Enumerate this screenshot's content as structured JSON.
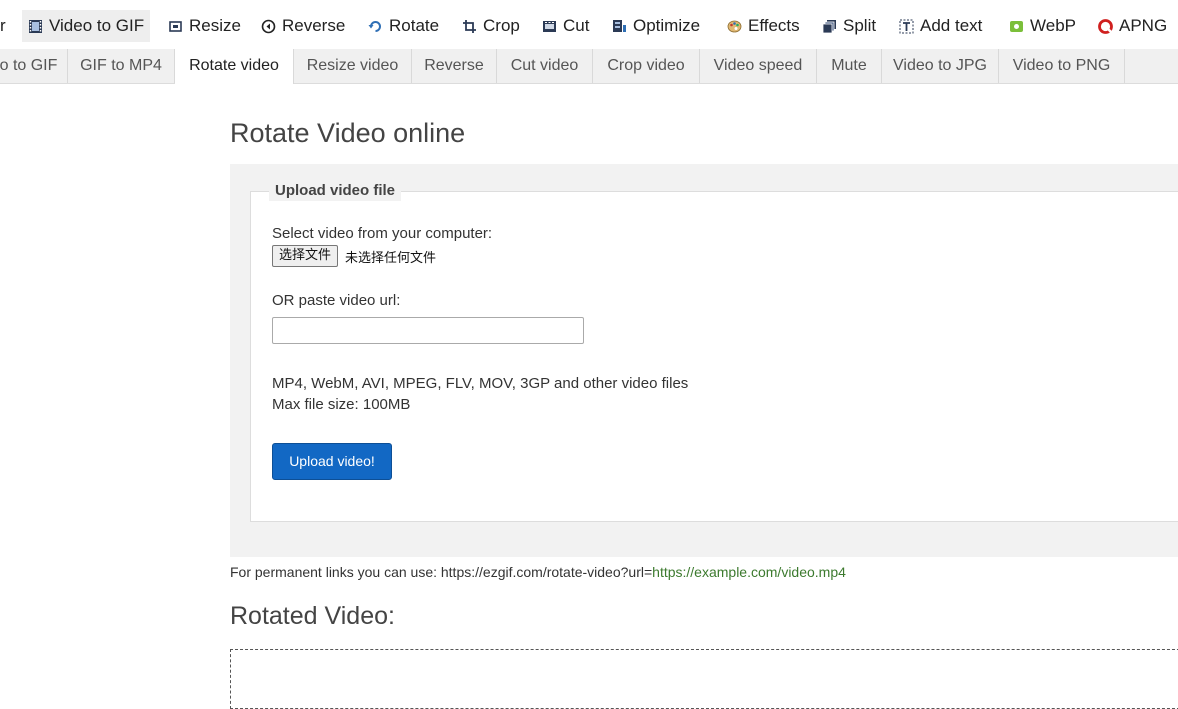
{
  "topnav": {
    "items": [
      {
        "label": "r",
        "icon": "partial-icon"
      },
      {
        "label": "Video to GIF",
        "icon": "film-icon",
        "active": true
      },
      {
        "label": "Resize",
        "icon": "resize-icon"
      },
      {
        "label": "Reverse",
        "icon": "reverse-icon"
      },
      {
        "label": "Rotate",
        "icon": "rotate-icon"
      },
      {
        "label": "Crop",
        "icon": "crop-icon"
      },
      {
        "label": "Cut",
        "icon": "cut-icon"
      },
      {
        "label": "Optimize",
        "icon": "optimize-icon"
      },
      {
        "label": "Effects",
        "icon": "palette-icon"
      },
      {
        "label": "Split",
        "icon": "split-icon"
      },
      {
        "label": "Add text",
        "icon": "text-icon"
      },
      {
        "label": "WebP",
        "icon": "webp-icon"
      },
      {
        "label": "APNG",
        "icon": "apng-icon"
      }
    ]
  },
  "subnav": {
    "tabs": [
      {
        "label": "o to GIF"
      },
      {
        "label": "GIF to MP4"
      },
      {
        "label": "Rotate video",
        "active": true
      },
      {
        "label": "Resize video"
      },
      {
        "label": "Reverse"
      },
      {
        "label": "Cut video"
      },
      {
        "label": "Crop video"
      },
      {
        "label": "Video speed"
      },
      {
        "label": "Mute"
      },
      {
        "label": "Video to JPG"
      },
      {
        "label": "Video to PNG"
      }
    ]
  },
  "main": {
    "title": "Rotate Video online",
    "upload": {
      "legend": "Upload video file",
      "select_label": "Select video from your computer:",
      "file_button": "选择文件",
      "file_status": "未选择任何文件",
      "url_label": "OR paste video url:",
      "url_value": "",
      "formats": "MP4, WebM, AVI, MPEG, FLV, MOV, 3GP and other video files",
      "max_size": "Max file size: 100MB",
      "submit": "Upload video!"
    },
    "permanent_links": {
      "prefix": "For permanent links you can use: https://ezgif.com/rotate-video?url=",
      "example_url": "https://example.com/video.mp4"
    },
    "result_title": "Rotated Video:"
  },
  "colors": {
    "accent": "#1268c4",
    "link": "#3c7a2e",
    "active_tab_bg": "#eeeeee"
  }
}
